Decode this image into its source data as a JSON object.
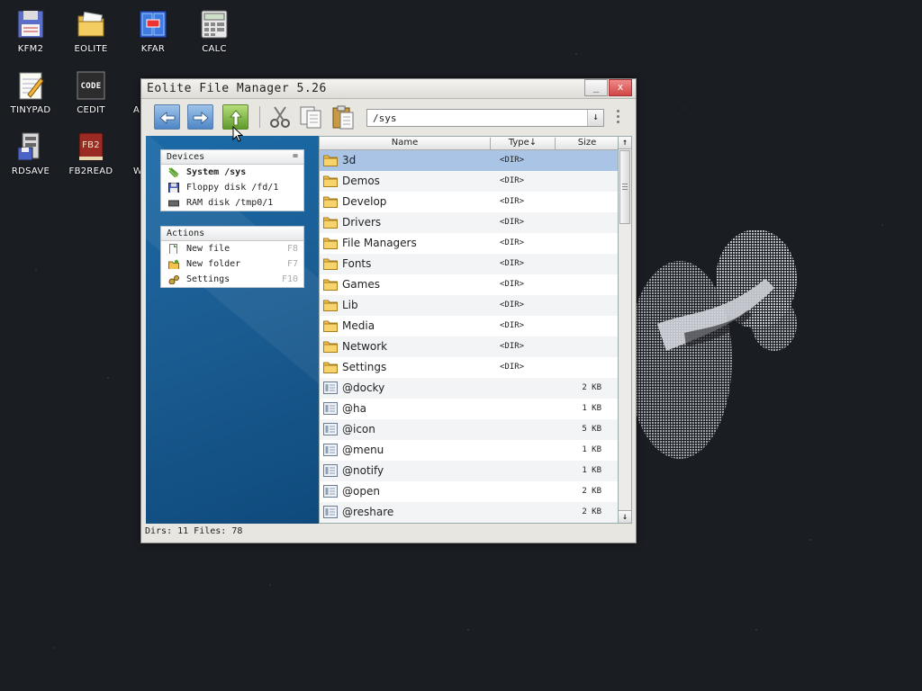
{
  "desktop": {
    "icons": [
      {
        "label": "KFM2",
        "icon": "floppy-icon"
      },
      {
        "label": "EOLITE",
        "icon": "folder-icon"
      },
      {
        "label": "KFAR",
        "icon": "archive-icon"
      },
      {
        "label": "CALC",
        "icon": "calculator-icon"
      },
      {
        "label": "TINYPAD",
        "icon": "notepad-icon"
      },
      {
        "label": "CEDIT",
        "icon": "code-editor-icon",
        "badge": "CODE"
      },
      {
        "label": "AN",
        "icon": "app-icon"
      },
      {
        "label": "RDSAVE",
        "icon": "rdsave-icon"
      },
      {
        "label": "FB2READ",
        "icon": "book-icon",
        "badge": "FB2"
      },
      {
        "label": "WI",
        "icon": "app-icon"
      }
    ]
  },
  "window": {
    "title": "Eolite File Manager 5.26",
    "min_label": "_",
    "close_label": "x"
  },
  "toolbar": {
    "path": "/sys",
    "path_arrow": "↓"
  },
  "devices": {
    "title": "Devices",
    "menu_glyph": "=",
    "items": [
      {
        "label": "System /sys",
        "icon": "system-disk-icon"
      },
      {
        "label": "Floppy disk /fd/1",
        "icon": "floppy-disk-icon"
      },
      {
        "label": "RAM disk /tmp0/1",
        "icon": "ram-disk-icon"
      }
    ]
  },
  "actions": {
    "title": "Actions",
    "items": [
      {
        "label": "New file",
        "key": "F8",
        "icon": "new-file-icon"
      },
      {
        "label": "New folder",
        "key": "F7",
        "icon": "new-folder-icon"
      },
      {
        "label": "Settings",
        "key": "F10",
        "icon": "settings-icon"
      }
    ]
  },
  "filelist": {
    "columns": {
      "name": "Name",
      "type": "Type↓",
      "size": "Size"
    },
    "scroll_up": "↑",
    "scroll_down": "↓",
    "rows": [
      {
        "name": "3d",
        "type": "<DIR>",
        "size": ""
      },
      {
        "name": "Demos",
        "type": "<DIR>",
        "size": ""
      },
      {
        "name": "Develop",
        "type": "<DIR>",
        "size": ""
      },
      {
        "name": "Drivers",
        "type": "<DIR>",
        "size": ""
      },
      {
        "name": "File Managers",
        "type": "<DIR>",
        "size": ""
      },
      {
        "name": "Fonts",
        "type": "<DIR>",
        "size": ""
      },
      {
        "name": "Games",
        "type": "<DIR>",
        "size": ""
      },
      {
        "name": "Lib",
        "type": "<DIR>",
        "size": ""
      },
      {
        "name": "Media",
        "type": "<DIR>",
        "size": ""
      },
      {
        "name": "Network",
        "type": "<DIR>",
        "size": ""
      },
      {
        "name": "Settings",
        "type": "<DIR>",
        "size": ""
      },
      {
        "name": "@docky",
        "type": "",
        "size": "2 KB"
      },
      {
        "name": "@ha",
        "type": "",
        "size": "1 KB"
      },
      {
        "name": "@icon",
        "type": "",
        "size": "5 KB"
      },
      {
        "name": "@menu",
        "type": "",
        "size": "1 KB"
      },
      {
        "name": "@notify",
        "type": "",
        "size": "1 KB"
      },
      {
        "name": "@open",
        "type": "",
        "size": "2 KB"
      },
      {
        "name": "@reshare",
        "type": "",
        "size": "2 KB"
      }
    ]
  },
  "status": {
    "text": "Dirs: 11   Files: 78"
  },
  "colors": {
    "selection": "#aac4e6",
    "sidebar_blue": "#1b5d93",
    "folder_yellow": "#f2c14e"
  }
}
